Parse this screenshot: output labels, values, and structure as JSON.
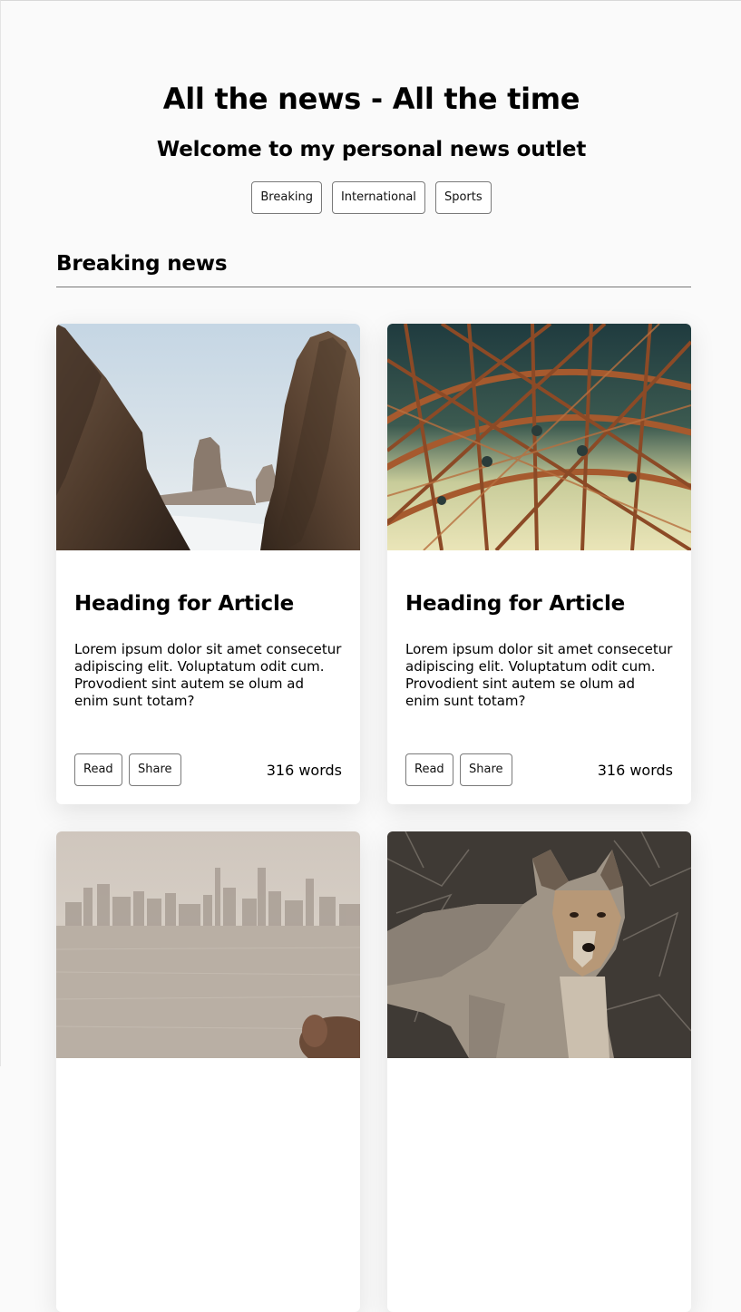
{
  "header": {
    "title": "All the news - All the time",
    "subtitle": "Welcome to my personal news outlet"
  },
  "nav": {
    "items": [
      {
        "label": "Breaking"
      },
      {
        "label": "International"
      },
      {
        "label": "Sports"
      }
    ]
  },
  "section": {
    "heading": "Breaking news"
  },
  "articles": [
    {
      "image": "sea-rocks-photo",
      "heading": "Heading for Article",
      "text": "Lorem ipsum dolor sit amet consecetur adipiscing elit. Voluptatum odit cum. Provodient sint autem se olum ad enim sunt totam?",
      "read_label": "Read",
      "share_label": "Share",
      "word_count": "316 words"
    },
    {
      "image": "bridge-steel-structure-photo",
      "heading": "Heading for Article",
      "text": "Lorem ipsum dolor sit amet consecetur adipiscing elit. Voluptatum odit cum. Provodient sint autem se olum ad enim sunt totam?",
      "read_label": "Read",
      "share_label": "Share",
      "word_count": "316 words"
    },
    {
      "image": "foggy-city-skyline-photo"
    },
    {
      "image": "coyote-photo"
    }
  ],
  "colors": {
    "page_background": "#fafafa",
    "card_background": "#ffffff",
    "button_border": "#7a7a7a",
    "rule": "#777777"
  }
}
